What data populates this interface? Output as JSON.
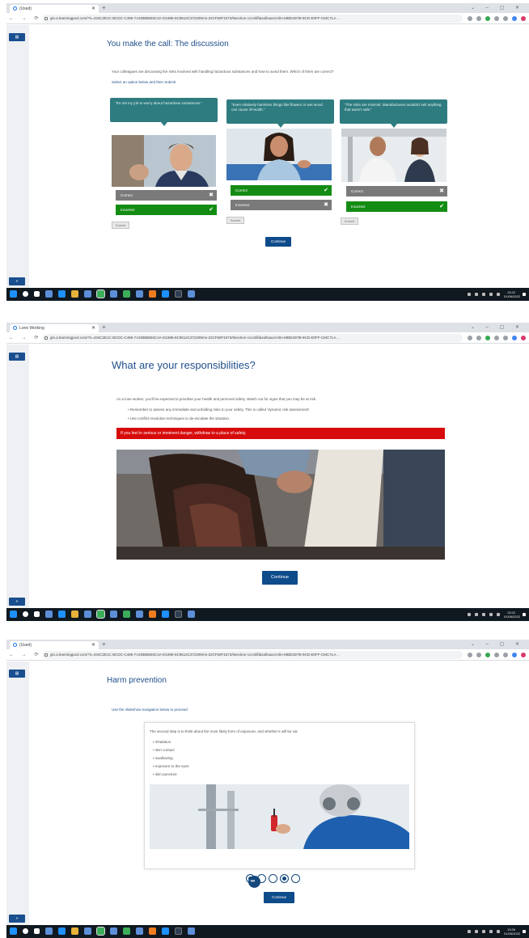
{
  "screenshots": [
    {
      "browser": {
        "tab_title": "(Used)",
        "url": "gin.a.learningpool.com/?s=434C2E1C BCDC-C496-7A2DBB6E6C4A-D1986-5C9514C372290ms-22CF60F1572/9section-cccmlifi&sollsaurcmlm-MBD4D7B-9CD-E0FF-CMC7LA..."
      },
      "sidebar": {
        "top_label": "▤",
        "bottom_label": "»"
      },
      "page": {
        "title": "You make the call: The discussion",
        "intro": "Your colleagues are discussing the risks involved with handling hazardous substances and how to avoid them. Which of them are correct?",
        "instruction": "Select an option below and then Submit",
        "cards": [
          {
            "bubble": "\"It's not my job to worry about hazardous substances.\"",
            "options": [
              {
                "label": "Correct",
                "state": "grey",
                "mark": "✖"
              },
              {
                "label": "Incorrect",
                "state": "green",
                "mark": "✔"
              }
            ],
            "submit": "Submit"
          },
          {
            "bubble": "\"Even relatively harmless things like flowers or wet wood can cause ill-health.\"",
            "options": [
              {
                "label": "Correct",
                "state": "green",
                "mark": "✔"
              },
              {
                "label": "Incorrect",
                "state": "grey",
                "mark": "✖"
              }
            ],
            "submit": "Submit"
          },
          {
            "bubble": "\"The risks are minimal. Manufacturers wouldn't sell anything that wasn't safe.\"",
            "options": [
              {
                "label": "Correct",
                "state": "grey",
                "mark": "✖"
              },
              {
                "label": "Incorrect",
                "state": "green",
                "mark": "✔"
              }
            ],
            "submit": "Submit"
          }
        ],
        "continue": "Continue"
      },
      "taskbar": {
        "time": "13:22",
        "date": "01/06/2022"
      }
    },
    {
      "browser": {
        "tab_title": "Lone Working",
        "url": "gin.a.learningpool.com/?s=434C2E1C BCDC-C496-7A2DBB6E6C4A-D1986-5C9514C372290ms-22CF60F1572/9section-cccmlifi&sollsaurcmlm-MBD4D7B-9CD-E0FF-CMC7LA..."
      },
      "sidebar": {
        "top_label": "▤",
        "bottom_label": "»"
      },
      "page": {
        "title": "What are your responsibilities?",
        "intro": "As a lone worker, you'll be expected to prioritise your health and personal safety. Watch out for signs that you may be at risk.",
        "bullets": [
          "Remember to assess any immediate and unfolding risks to your safety. This is called 'dynamic risk assessment'.",
          "Use conflict resolution techniques to de-escalate the situation."
        ],
        "warning": "If you feel in serious or imminent danger, withdraw to a place of safety.",
        "continue": "Continue"
      },
      "taskbar": {
        "time": "13:22",
        "date": "01/06/2022"
      }
    },
    {
      "browser": {
        "tab_title": "(Used)",
        "url": "gin.a.learningpool.com/?s=434C2E1C BCDC-C496-7A2DBB6E6C4A-D1986-5C9514C372290ms-22CF60F1572/9section-cccmlifi&sollsaurcmlm-MBD4D7B-9CD-E0FF-CMC7LA..."
      },
      "sidebar": {
        "top_label": "▤",
        "bottom_label": "»"
      },
      "page": {
        "title": "Harm prevention",
        "instruction": "Use the slideshow navigation below to proceed",
        "card_intro": "The second step is to think about the most likely form of exposure, and whether it will be via:",
        "card_items": [
          "inhalation",
          "skin contact",
          "swallowing",
          "exposure to the eyes",
          "skin puncture"
        ],
        "slides_total": 6,
        "slides_active": 4,
        "nav_label": "⏭",
        "continue": "Continue"
      },
      "taskbar": {
        "time": "13:26",
        "date": "01/06/2022"
      }
    }
  ]
}
